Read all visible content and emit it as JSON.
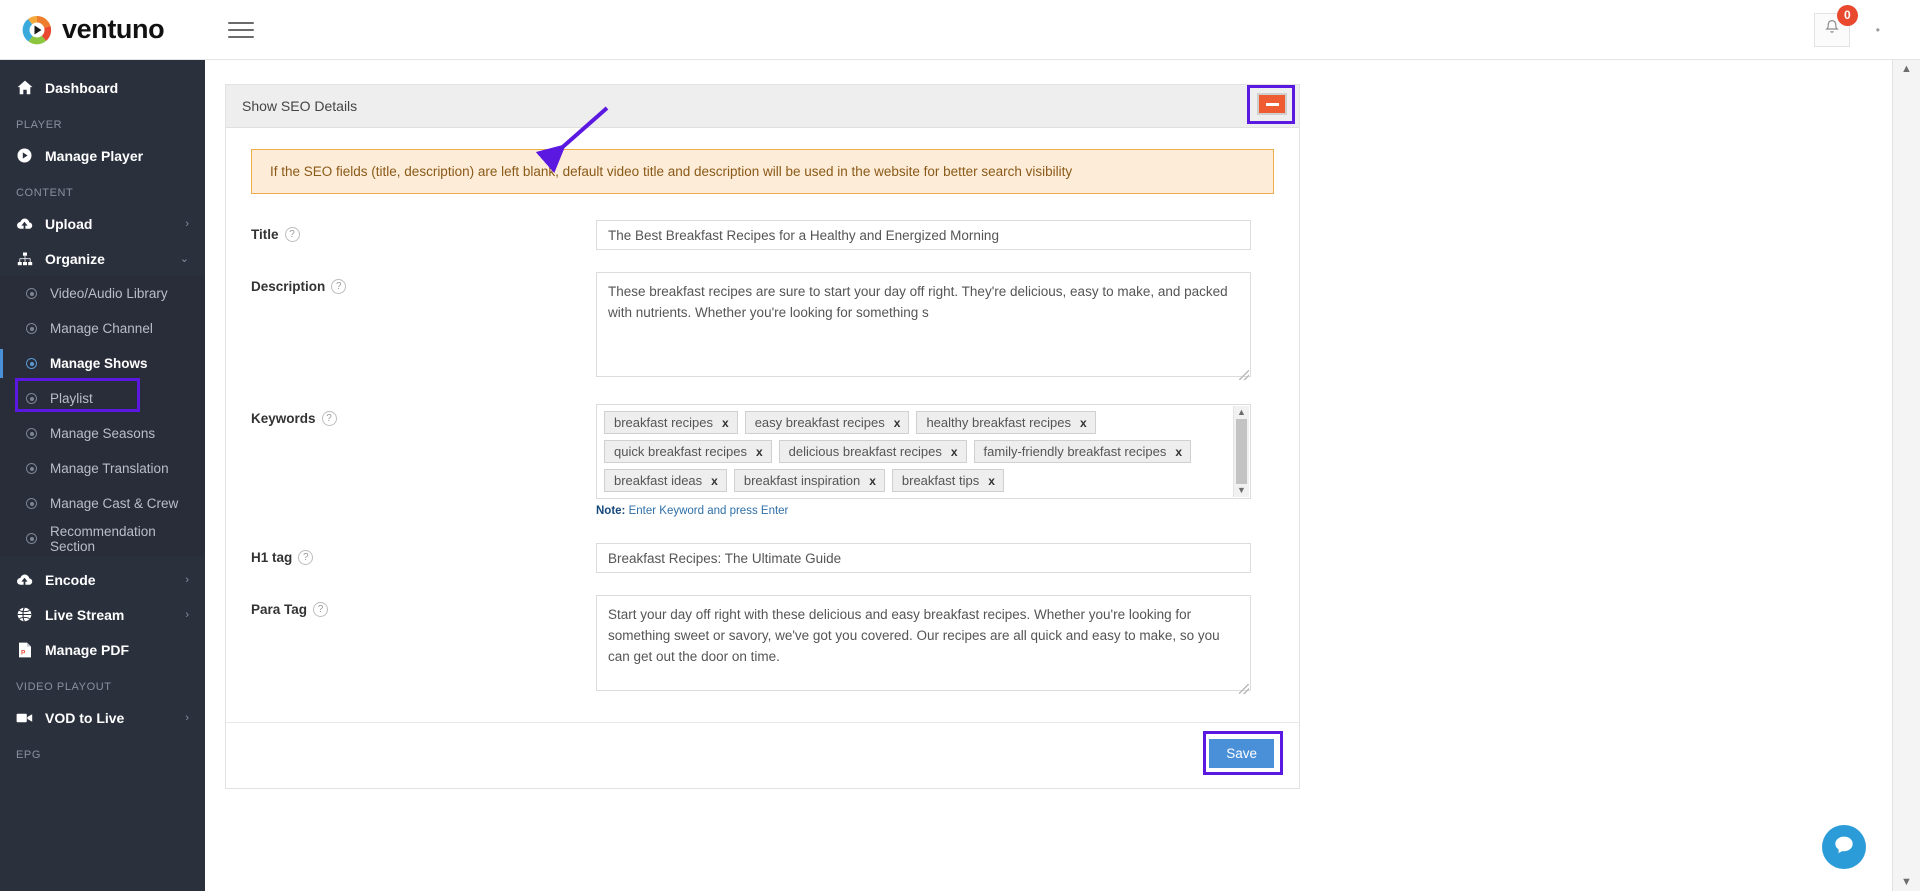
{
  "topbar": {
    "brand": "ventuno",
    "menu_icon": "hamburger-icon",
    "notification_count": "0"
  },
  "sidebar": {
    "dashboard": {
      "label": "Dashboard",
      "icon": "home-icon"
    },
    "sections": [
      {
        "label": "PLAYER",
        "items": [
          {
            "label": "Manage Player",
            "icon": "play-circle-icon",
            "chevron": ""
          }
        ]
      },
      {
        "label": "CONTENT",
        "items": [
          {
            "label": "Upload",
            "icon": "cloud-upload-icon",
            "chevron": "›"
          },
          {
            "label": "Organize",
            "icon": "sitemap-icon",
            "chevron": "⌄"
          }
        ]
      }
    ],
    "organize_children": [
      {
        "label": "Video/Audio Library",
        "active": false
      },
      {
        "label": "Manage Channel",
        "active": false
      },
      {
        "label": "Manage Shows",
        "active": true
      },
      {
        "label": "Playlist",
        "active": false
      },
      {
        "label": "Manage Seasons",
        "active": false
      },
      {
        "label": "Manage Translation",
        "active": false
      },
      {
        "label": "Manage Cast & Crew",
        "active": false
      },
      {
        "label": "Recommendation Section",
        "active": false
      }
    ],
    "content_tail": [
      {
        "label": "Encode",
        "icon": "cloud-upload-icon",
        "chevron": "›"
      },
      {
        "label": "Live Stream",
        "icon": "globe-icon",
        "chevron": "›"
      },
      {
        "label": "Manage PDF",
        "icon": "pdf-file-icon",
        "chevron": ""
      }
    ],
    "playout_section": {
      "label": "VIDEO PLAYOUT",
      "items": [
        {
          "label": "VOD to Live",
          "icon": "video-camera-icon",
          "chevron": "›"
        }
      ]
    },
    "epg_section": {
      "label": "EPG"
    }
  },
  "panel": {
    "title": "Show SEO Details",
    "collapse_icon": "minus-icon",
    "alert": "If the SEO fields (title, description) are left blank, default video title and description will be used in the website for better search visibility",
    "fields": {
      "title": {
        "label": "Title",
        "help": "?",
        "value": "The Best Breakfast Recipes for a Healthy and Energized Morning"
      },
      "description": {
        "label": "Description",
        "help": "?",
        "value": "These breakfast recipes are sure to start your day off right. They're delicious, easy to make, and packed with nutrients. Whether you're looking for something s"
      },
      "keywords": {
        "label": "Keywords",
        "help": "?",
        "note_prefix": "Note:",
        "note": " Enter Keyword and press Enter",
        "remove_label": "x",
        "tags": [
          "breakfast recipes",
          "easy breakfast recipes",
          "healthy breakfast recipes",
          "quick breakfast recipes",
          "delicious breakfast recipes",
          "family-friendly breakfast recipes",
          "breakfast ideas",
          "breakfast inspiration",
          "breakfast tips"
        ]
      },
      "h1tag": {
        "label": "H1 tag",
        "help": "?",
        "value": "Breakfast Recipes: The Ultimate Guide"
      },
      "paratag": {
        "label": "Para Tag",
        "help": "?",
        "value": "Start your day off right with these delicious and easy breakfast recipes. Whether you're looking for something sweet or savory, we've got you covered. Our recipes are all quick and easy to make, so you can get out the door on time."
      }
    },
    "save_label": "Save"
  },
  "annotations": {
    "arrow_color": "#5b18e0",
    "highlight_color": "#5b18e0",
    "targets": [
      "Show SEO Details",
      "Manage Shows",
      "collapse-button",
      "Save"
    ]
  },
  "colors": {
    "accent_blue": "#4a90d9",
    "sidebar_bg": "#2b303d",
    "alert_bg": "#fdecd8",
    "alert_border": "#f0ad4e",
    "collapse_orange": "#ef5b33",
    "badge_red": "#e8492f",
    "chat_blue": "#2b9cd8"
  },
  "chat": {
    "icon": "chat-bubble-icon"
  },
  "scroll": {
    "up_arrow": "▲",
    "down_arrow": "▼"
  }
}
